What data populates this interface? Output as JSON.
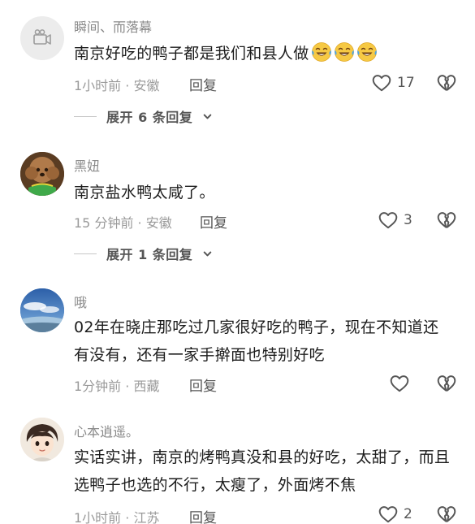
{
  "comments": [
    {
      "username": "瞬间、而落幕",
      "text": "南京好吃的鸭子都是我们和县人做",
      "emoji": "laughing-crying-emoji",
      "emoji_count": 3,
      "time_location": "1小时前 · 安徽",
      "reply_label": "回复",
      "like_count": "17",
      "expand_label": "展开 6 条回复"
    },
    {
      "username": "黑妞",
      "text": "南京盐水鸭太咸了。",
      "time_location": "15 分钟前 · 安徽",
      "reply_label": "回复",
      "like_count": "3",
      "expand_label": "展开 1 条回复"
    },
    {
      "username": "哦",
      "text": "02年在晓庄那吃过几家很好吃的鸭子，现在不知道还有没有，还有一家手擀面也特别好吃",
      "time_location": "1分钟前 · 西藏",
      "reply_label": "回复",
      "like_count": ""
    },
    {
      "username": "心本逍遥。",
      "text": "实话实讲，南京的烤鸭真没和县的好吃，太甜了，而且选鸭子也选的不行，太瘦了，外面烤不焦",
      "time_location": "1小时前 · 江苏",
      "reply_label": "回复",
      "like_count": "2"
    }
  ],
  "colors": {
    "meta_gray": "#9a9a9a",
    "text": "#1c1c1c",
    "emoji_yellow": "#f6c944",
    "emoji_tear": "#4aa3e8"
  }
}
